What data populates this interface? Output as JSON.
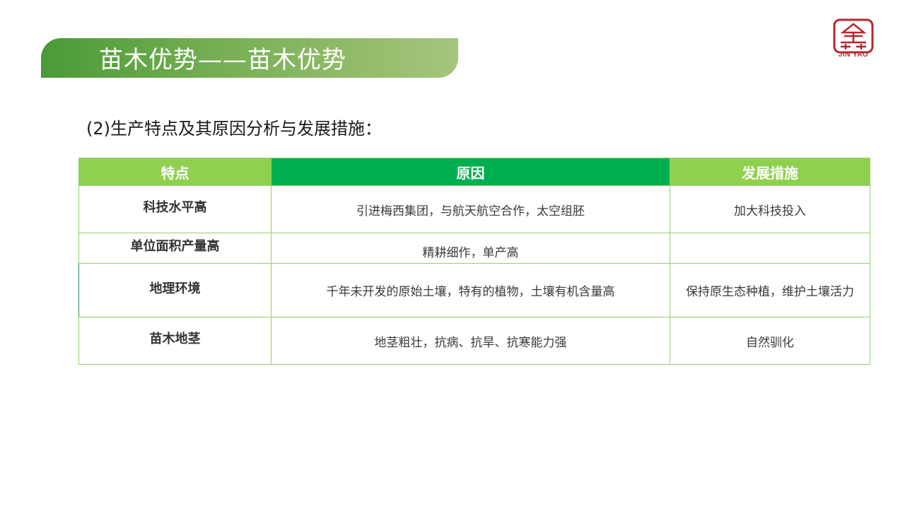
{
  "header": {
    "title": "苗木优势——苗木优势"
  },
  "logo": {
    "caption": "JIN YAO"
  },
  "section": {
    "subtitle": "(2)生产特点及其原因分析与发展措施："
  },
  "table": {
    "headers": [
      "特点",
      "原因",
      "发展措施"
    ],
    "rows": [
      {
        "feature": "科技水平高",
        "reason": "引进梅西集团，与航天航空合作，太空组胚",
        "measure": "加大科技投入"
      },
      {
        "feature": "单位面积产量高",
        "reason": "精耕细作，单产高",
        "measure": ""
      },
      {
        "feature": "地理环境",
        "reason": "千年未开发的原始土壤，特有的植物，土壤有机含量高",
        "measure": "保持原生态种植，维护土壤活力"
      },
      {
        "feature": "苗木地茎",
        "reason": "地茎粗壮，抗病、抗旱、抗寒能力强",
        "measure": "自然驯化"
      }
    ]
  },
  "colors": {
    "title_gradient_start": "#4a9a38",
    "title_gradient_end": "#a6c57c",
    "header_light_green": "#8fd14f",
    "header_dark_green": "#00b050",
    "table_border": "#8fd16a",
    "logo_red": "#b8262c"
  }
}
